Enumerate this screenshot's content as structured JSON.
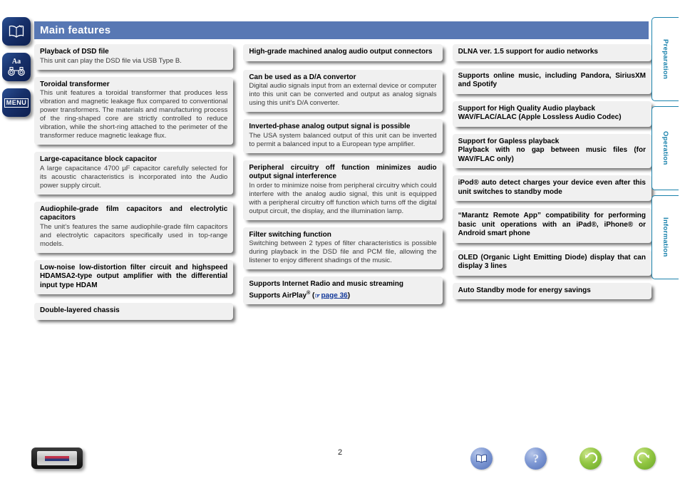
{
  "header": {
    "title": "Main features"
  },
  "sidebar": {
    "items": [
      {
        "name": "manual-book-button",
        "icon": "open-book-icon"
      },
      {
        "name": "font-size-binoculars-button",
        "icon": "aa-binoculars-icon",
        "label": "Aa"
      },
      {
        "name": "menu-button",
        "icon": "menu-icon",
        "label": "MENU"
      }
    ]
  },
  "columns": [
    {
      "boxes": [
        {
          "title": "Playback of DSD file",
          "body": "This unit can play the DSD file via USB Type B."
        },
        {
          "title": "Toroidal transformer",
          "body": "This unit features a toroidal transformer that produces less vibration and magnetic leakage flux compared to conventional power transformers. The materials and manufacturing process of the ring-shaped core are strictly controlled to reduce vibration, while the short-ring attached to the perimeter of the transformer reduce magnetic leakage flux."
        },
        {
          "title": "Large-capacitance block capacitor",
          "body": "A large capacitance 4700 µF capacitor carefully selected for its acoustic characteristics is incorporated into the Audio power supply circuit."
        },
        {
          "title": "Audiophile-grade film capacitors and electrolytic capacitors",
          "body": "The unit’s features the same audiophile-grade film capacitors and electrolytic capacitors specifically used in top-range models."
        },
        {
          "title": "Low-noise low-distortion filter circuit and highspeed HDAMSA2-type output amplifier with the differential input type HDAM",
          "body": ""
        },
        {
          "title": "Double-layered chassis",
          "body": ""
        }
      ]
    },
    {
      "boxes": [
        {
          "title": "High-grade machined analog audio output connectors",
          "body": ""
        },
        {
          "title": "Can be used as a D/A convertor",
          "body": "Digital audio signals input from an external device or computer into this unit can be converted and output as analog signals using this unit's D/A converter."
        },
        {
          "title": "Inverted-phase analog output signal is possible",
          "body": "The USA system balanced output of this unit can be inverted to permit a balanced input to a European type amplifier."
        },
        {
          "title": "Peripheral circuitry off function minimizes audio output signal interference",
          "body": "In order to minimize noise from peripheral circuitry which could interfere with the analog audio signal, this unit is equipped with a peripheral circuitry off function which turns off the digital output circuit, the display, and the illumination lamp."
        },
        {
          "title": "Filter switching function",
          "body": "Switching between 2 types of filter characteristics is possible during playback in the DSD file and PCM file, allowing the listener to enjoy different shadings of the music."
        }
      ],
      "airplay_box": {
        "line1": "Supports Internet Radio and music streaming",
        "line2_pre": "Supports AirPlay",
        "line2_sup": "®",
        "paren_open": " (",
        "link": "page 36",
        "paren_close": ")"
      }
    },
    {
      "boxes": [
        {
          "title": "DLNA ver. 1.5 support for audio networks",
          "body": ""
        },
        {
          "title": "Supports online music, including Pandora, SiriusXM and Spotify",
          "body": ""
        },
        {
          "title": "Support for High Quality Audio playback\nWAV/FLAC/ALAC (Apple Lossless Audio Codec)",
          "body": ""
        },
        {
          "title": "Support for Gapless playback\nPlayback with no gap between music files (for WAV/FLAC only)",
          "body": ""
        },
        {
          "title": "iPod® auto detect charges your device even after this unit switches to standby mode",
          "body": ""
        },
        {
          "title": "“Marantz Remote App” compatibility for performing basic unit operations with an iPad®, iPhone® or Android smart phone",
          "body": ""
        },
        {
          "title": "OLED (Organic Light Emitting Diode) display that can display 3 lines",
          "body": ""
        },
        {
          "title": "Auto Standby mode for energy savings",
          "body": ""
        }
      ]
    }
  ],
  "tabs": [
    {
      "label": "Preparation"
    },
    {
      "label": "Operation"
    },
    {
      "label": "Information"
    }
  ],
  "footer": {
    "page_number": "2",
    "device_button": "device-image-button",
    "nav_icons": [
      {
        "name": "contents-book-icon",
        "color": "#5471b8"
      },
      {
        "name": "help-question-icon",
        "color": "#5471b8",
        "glyph": "?"
      },
      {
        "name": "back-arrow-icon",
        "color": "#93c743"
      },
      {
        "name": "forward-arrow-icon",
        "color": "#93c743"
      }
    ]
  },
  "colors": {
    "header_blue": "#5878b4",
    "tab_teal": "#1a82ac",
    "link_blue": "#13399a",
    "box_bg": "#f0f0f0",
    "sidebar_blue": "#17306a"
  }
}
